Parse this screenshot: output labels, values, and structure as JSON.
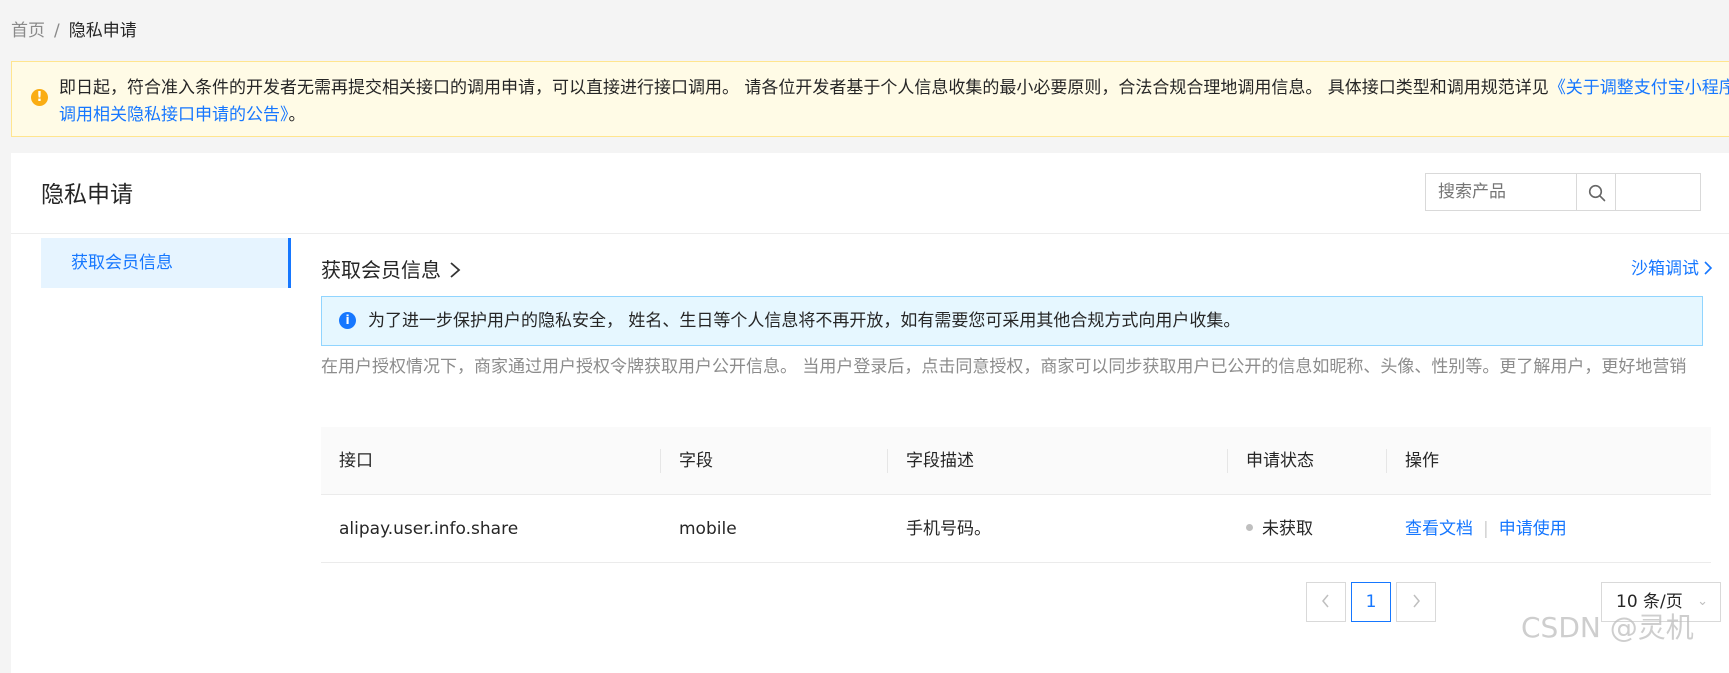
{
  "breadcrumb": {
    "home": "首页",
    "separator": "/",
    "current": "隐私申请"
  },
  "banner": {
    "icon": "warning-icon",
    "text": "即日起，符合准入条件的开发者无需再提交相关接口的调用申请，可以直接进行接口调用。 请各位开发者基于个人信息收集的最小必要原则，合法合规合理地调用信息。 具体接口类型和调用规范详见",
    "link_text": "《关于调整支付宝小程序调用相关隐私接口申请的公告》",
    "suffix": "。"
  },
  "card": {
    "title": "隐私申请",
    "search": {
      "placeholder": "搜索产品",
      "icon": "search-icon"
    }
  },
  "side_nav": {
    "items": [
      {
        "label": "获取会员信息",
        "active": true
      }
    ]
  },
  "section": {
    "title": "获取会员信息",
    "title_icon": "chevron-right-icon",
    "sandbox_link": "沙箱调试",
    "sandbox_icon": "chevron-right-icon",
    "info_alert": {
      "icon": "info-icon",
      "text": "为了进一步保护用户的隐私安全， 姓名、生日等个人信息将不再开放，如有需要您可采用其他合规方式向用户收集。"
    },
    "description": "在用户授权情况下，商家通过用户授权令牌获取用户公开信息。 当用户登录后，点击同意授权，商家可以同步获取用户已公开的信息如昵称、头像、性别等。更了解用户，更好地营销"
  },
  "table": {
    "headers": [
      "接口",
      "字段",
      "字段描述",
      "申请状态",
      "操作"
    ],
    "rows": [
      {
        "api": "alipay.user.info.share",
        "field": "mobile",
        "field_desc": "手机号码。",
        "status": "未获取",
        "actions": [
          "查看文档",
          "申请使用"
        ],
        "action_separator": "|"
      }
    ]
  },
  "pagination": {
    "prev_icon": "chevron-left-icon",
    "current_page": "1",
    "next_icon": "chevron-right-icon",
    "page_size": "10 条/页",
    "page_size_icon": "chevron-down-icon"
  },
  "watermark": "CSDN @灵机",
  "colors": {
    "primary": "#1677ff",
    "warning": "#faad14",
    "warning_bg": "#fffbe6",
    "info_bg": "#e6f7ff",
    "muted_text": "#8c8c8c"
  }
}
